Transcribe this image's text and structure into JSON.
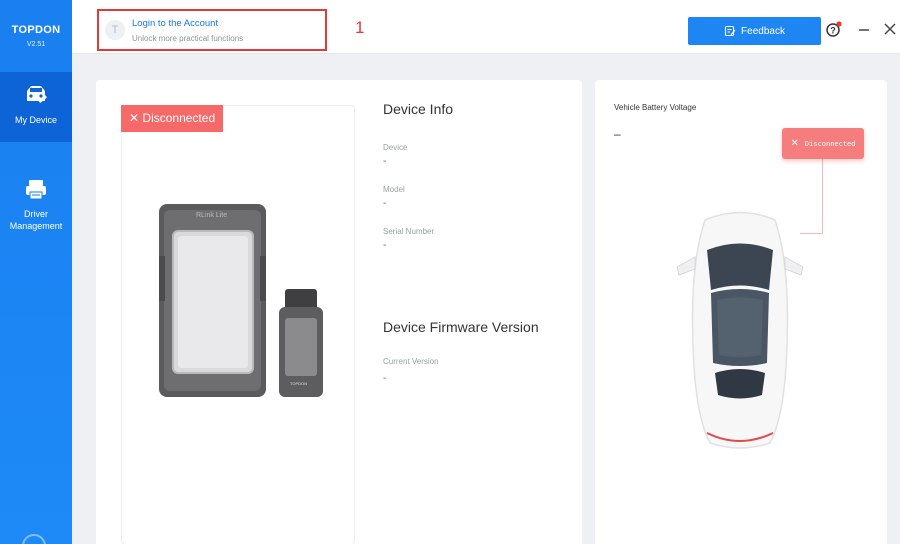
{
  "brand": {
    "name": "TOPDON",
    "version": "V2.51"
  },
  "sidebar": {
    "items": [
      {
        "label": "My Device",
        "icon": "car-wrench-icon",
        "active": true
      },
      {
        "label": "Driver Management",
        "icon": "driver-printer-icon",
        "active": false
      }
    ]
  },
  "header": {
    "login_title": "Login to the Account",
    "login_subtitle": "Unlock more practical functions",
    "avatar_letter": "T",
    "annotation": "1",
    "feedback_label": "Feedback"
  },
  "device": {
    "status": "Disconnected",
    "model_print": "RLink Lite",
    "vci_print": "TOPDON"
  },
  "info": {
    "title": "Device Info",
    "device_label": "Device",
    "device_value": "-",
    "model_label": "Model",
    "model_value": "-",
    "serial_label": "Serial Number",
    "serial_value": "-",
    "firmware_title": "Device Firmware Version",
    "current_label": "Current Version",
    "current_value": "-"
  },
  "vehicle": {
    "voltage_label": "Vehicle Battery Voltage",
    "voltage_value": "–",
    "status": "Disconnected"
  },
  "colors": {
    "accent": "#1e86f2",
    "sidebar": "#1a7ff0",
    "sidebar_active": "#0d64d6",
    "danger": "#f56969",
    "annotation": "#e53935"
  }
}
